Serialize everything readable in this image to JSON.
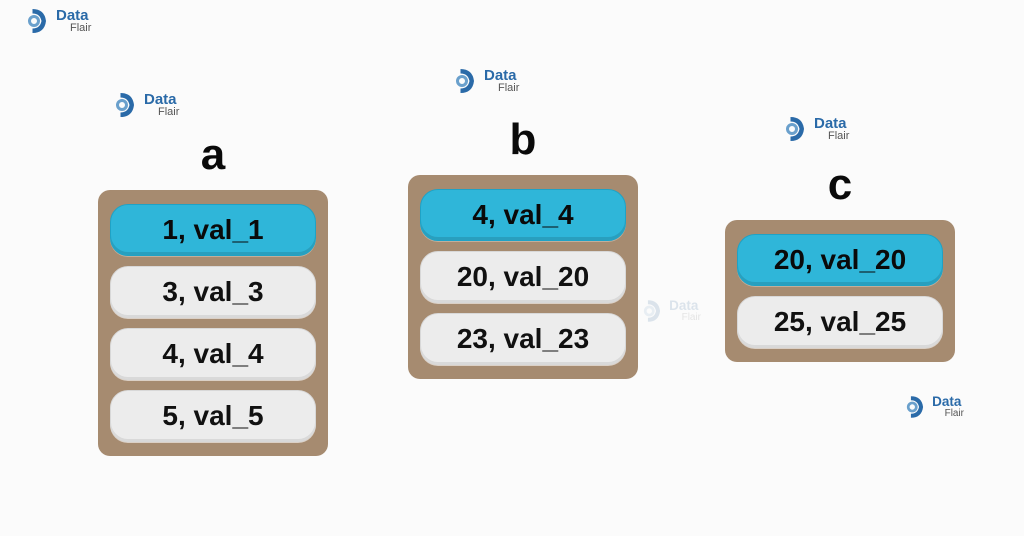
{
  "logo": {
    "line1": "Data",
    "line2": "Flair"
  },
  "columns": {
    "a": {
      "title": "a",
      "items": [
        {
          "label": "1, val_1",
          "hl": true
        },
        {
          "label": "3, val_3",
          "hl": false
        },
        {
          "label": "4, val_4",
          "hl": false
        },
        {
          "label": "5, val_5",
          "hl": false
        }
      ]
    },
    "b": {
      "title": "b",
      "items": [
        {
          "label": "4, val_4",
          "hl": true
        },
        {
          "label": "20, val_20",
          "hl": false
        },
        {
          "label": "23, val_23",
          "hl": false
        }
      ]
    },
    "c": {
      "title": "c",
      "items": [
        {
          "label": "20, val_20",
          "hl": true
        },
        {
          "label": "25, val_25",
          "hl": false
        }
      ]
    }
  }
}
